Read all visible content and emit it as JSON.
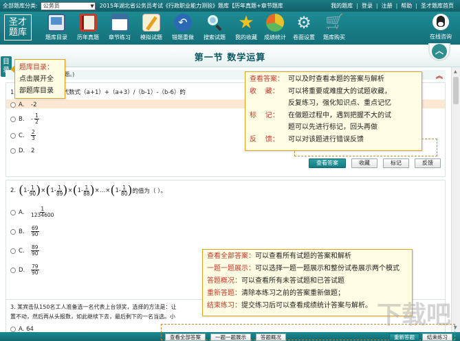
{
  "topbar": {
    "category_label": "全部题库分类:",
    "category_value": "公务员",
    "exam_title": "2015年湖北省公务员考试《行政职业能力测验》题库【历年真题+章节题库",
    "links": [
      "我的题库",
      "登录",
      "注册",
      "帮助",
      "圣才题库首页"
    ]
  },
  "logo": {
    "text": "圣才题库"
  },
  "toolbar": {
    "items": [
      {
        "label": "题库目录",
        "icon": "monitor-icon"
      },
      {
        "label": "历年真题",
        "icon": "book-icon"
      },
      {
        "label": "章节练习",
        "icon": "calendar-icon"
      },
      {
        "label": "模拟试题",
        "icon": "pencil-icon"
      },
      {
        "label": "错题重做",
        "icon": "undo-icon"
      },
      {
        "label": "搜索试题",
        "icon": "search-icon"
      },
      {
        "label": "我的收藏",
        "icon": "star-icon"
      },
      {
        "label": "成绩统计",
        "icon": "pie-chart-icon"
      },
      {
        "label": "卷面设置",
        "icon": "gear-icon"
      },
      {
        "label": "题库购买",
        "icon": "cart-icon"
      }
    ],
    "consult_label": "在线咨询"
  },
  "section": {
    "title": "第一节   数学运算"
  },
  "side_tab": {
    "text": "目录"
  },
  "hint": "5题。)",
  "q1": {
    "stem": "1.  (a+b)²=0，那么代数式（a+1）+（a+3）/（b-1）-（b-6）的",
    "options": [
      {
        "letter": "A.",
        "text": "-2"
      },
      {
        "letter": "B.",
        "text": "-",
        "frac_num": "1",
        "frac_den": "2"
      },
      {
        "letter": "C.",
        "text": "",
        "frac_num": "2",
        "frac_den": "3"
      },
      {
        "letter": "D.",
        "text": "2"
      }
    ],
    "buttons": [
      "查看答案",
      "收藏",
      "标记",
      "反馈"
    ]
  },
  "q2": {
    "number": "2.",
    "terms": [
      {
        "num": "1",
        "den": "90"
      },
      {
        "num": "1",
        "den": "89"
      },
      {
        "num": "1",
        "den": "88"
      },
      {
        "num": "1",
        "den": "80"
      }
    ],
    "ellipsis": "×…×",
    "tail": "的值为（    ）。",
    "options": [
      {
        "letter": "A.",
        "num": "1",
        "den": "1234600"
      },
      {
        "letter": "B.",
        "num": "69",
        "den": "90"
      },
      {
        "letter": "C.",
        "num": "89",
        "den": "90"
      },
      {
        "letter": "D.",
        "num": "79",
        "den": "90"
      }
    ]
  },
  "q3": {
    "stem_line1": "3. 某宾击队150名工人准备选一名代表上台领奖，选择的方法是：让",
    "stem_line2": "置不动，然后再从头报数，如此继续下去，最后剩下的一名当选。小",
    "option_a": "A.  64"
  },
  "callouts": {
    "directory": {
      "title": "题库目录：",
      "line2": "点击展开全",
      "line3": "部题库目录"
    },
    "answer": [
      {
        "k": "查看答案：",
        "v": "可以及时查看本题的答案与解析"
      },
      {
        "k": "收    藏：",
        "v": "可以将重要或难度大的试题收藏，"
      },
      {
        "k": "",
        "v": "反复练习，强化知识点、重点记忆"
      },
      {
        "k": "标    记：",
        "v": "在做题过程中，遇到把握不大的试"
      },
      {
        "k": "",
        "v": "题可以先进行标记，回头再做"
      },
      {
        "k": "反    馈：",
        "v": "可以对该题进行错误反馈"
      }
    ],
    "all": [
      {
        "k": "查看全部答案：",
        "v": "可以查看所有试题的答案和解析"
      },
      {
        "k": "一题一题展示：",
        "v": "可以选择一题一题展示和整份试卷展示两个模式"
      },
      {
        "k": "答题概况：",
        "v": "可以查看所有未答试题和已答试题"
      },
      {
        "k": "重新答题：",
        "v": "清除本练习之前的答案重新做题；"
      },
      {
        "k": "结束练习：",
        "v": "提交练习后可以查看成绩统计答案与解析。"
      }
    ]
  },
  "bottom": {
    "buttons": [
      "查看全部答案",
      "一题一题展示",
      "答题概况"
    ],
    "right_buttons": [
      "重新答题",
      "结束练习"
    ]
  },
  "watermark": "下载吧"
}
